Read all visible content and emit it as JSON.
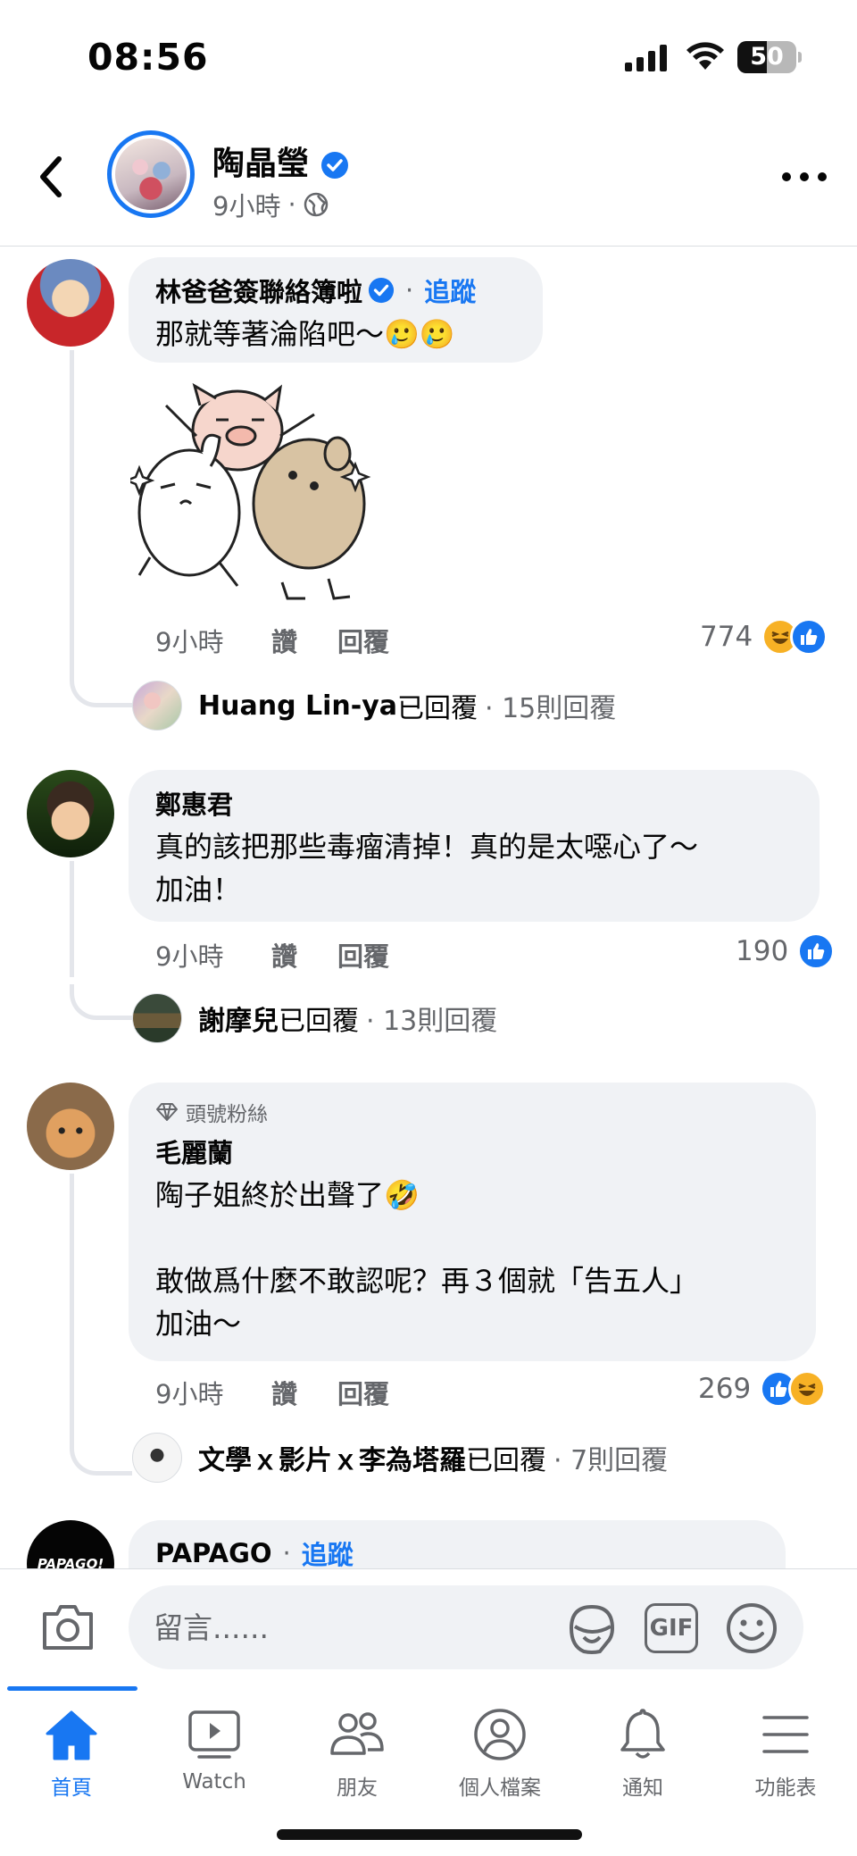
{
  "status_bar": {
    "time": "08:56",
    "battery": "50",
    "battery_level": 0.5
  },
  "header": {
    "page_name": "陶晶瑩",
    "meta_time": "9小時",
    "meta_sep": "·"
  },
  "comments": [
    {
      "author": "林爸爸簽聯絡簿啦",
      "follow_sep": "·",
      "follow": "追蹤",
      "text": "那就等著淪陷吧～🥲🥲",
      "time": "9小時",
      "like": "讚",
      "reply": "回覆",
      "reaction_count": "774",
      "reactions": [
        "haha-icon",
        "like-icon"
      ],
      "reply_summary": {
        "name": "Huang Lin-ya",
        "suffix": "已回覆",
        "count": "· 15則回覆"
      }
    },
    {
      "author": "鄭惠君",
      "text": "真的該把那些毒瘤清掉！真的是太噁心了～\n加油！",
      "time": "9小時",
      "like": "讚",
      "reply": "回覆",
      "reaction_count": "190",
      "reactions": [
        "like-icon"
      ],
      "reply_summary": {
        "name": "謝摩兒",
        "suffix": "已回覆",
        "count": "· 13則回覆"
      }
    },
    {
      "badge": "頭號粉絲",
      "author": "毛麗蘭",
      "text": "陶子姐終於出聲了🤣\n\n敢做爲什麼不敢認呢？再３個就「告五人」\n加油～",
      "time": "9小時",
      "like": "讚",
      "reply": "回覆",
      "reaction_count": "269",
      "reactions": [
        "like-icon",
        "haha-icon"
      ],
      "reply_summary": {
        "name": "文學ｘ影片ｘ李為塔羅",
        "suffix": "已回覆",
        "count": "· 7則回覆"
      }
    },
    {
      "author": "PAPAGO",
      "avatar_text": "PAPAGO!",
      "follow_sep": "·",
      "follow": "追蹤"
    }
  ],
  "composer": {
    "placeholder": "留言......",
    "gif": "GIF"
  },
  "tabs": [
    {
      "label": "首頁",
      "icon": "home-icon",
      "active": true
    },
    {
      "label": "Watch",
      "icon": "watch-icon"
    },
    {
      "label": "朋友",
      "icon": "friends-icon"
    },
    {
      "label": "個人檔案",
      "icon": "profile-icon"
    },
    {
      "label": "通知",
      "icon": "bell-icon"
    },
    {
      "label": "功能表",
      "icon": "menu-icon"
    }
  ],
  "colors": {
    "accent": "#1877f2",
    "bubble": "#f0f2f5",
    "secondary_text": "#65676b"
  }
}
